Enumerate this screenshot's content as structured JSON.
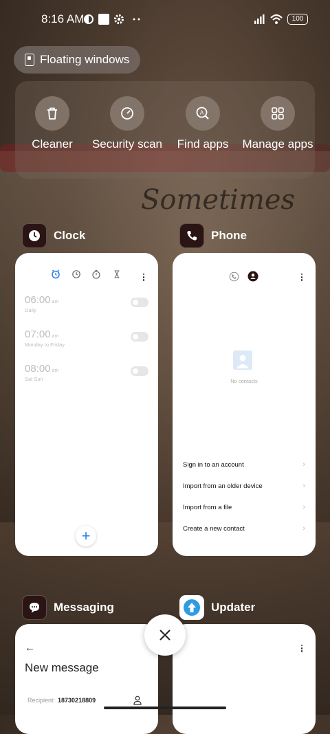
{
  "status_bar": {
    "time": "8:16 AM",
    "battery": "100"
  },
  "floating_windows": {
    "label": "Floating windows"
  },
  "actions": [
    {
      "label": "Cleaner",
      "icon": "trash-icon"
    },
    {
      "label": "Security scan",
      "icon": "shield-scan-icon"
    },
    {
      "label": "Find apps",
      "icon": "find-apps-icon"
    },
    {
      "label": "Manage apps",
      "icon": "grid-icon"
    }
  ],
  "background_text": "Sometimes",
  "apps": {
    "clock": {
      "name": "Clock",
      "alarms": [
        {
          "time": "06:00",
          "ampm": "am",
          "days": "Daily"
        },
        {
          "time": "07:00",
          "ampm": "am",
          "days": "Monday to Friday"
        },
        {
          "time": "08:00",
          "ampm": "am",
          "days": "Sat Sun"
        }
      ],
      "fab": "+"
    },
    "phone": {
      "name": "Phone",
      "empty_text": "No contacts",
      "options": [
        "Sign in to an account",
        "Import from an older device",
        "Import from a file",
        "Create a new contact"
      ]
    },
    "messaging": {
      "name": "Messaging",
      "back": "←",
      "title": "New message",
      "recipient_label": "Recipient:",
      "recipient_value": "18730218809"
    },
    "updater": {
      "name": "Updater"
    }
  },
  "colors": {
    "accent": "#2b7de9",
    "card": "#ffffff",
    "app_icon_bg": "#2a1414"
  }
}
